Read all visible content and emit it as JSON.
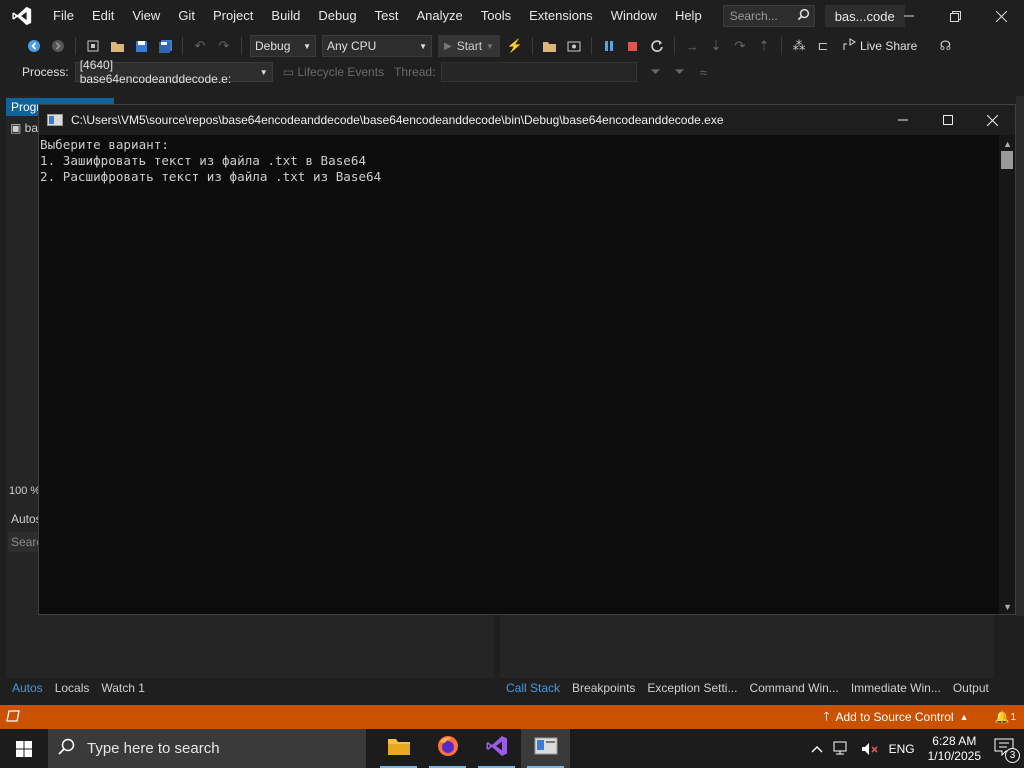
{
  "menubar": {
    "items": [
      "File",
      "Edit",
      "View",
      "Git",
      "Project",
      "Build",
      "Debug",
      "Test",
      "Analyze",
      "Tools",
      "Extensions",
      "Window",
      "Help"
    ],
    "search_placeholder": "Search...",
    "title": "bas...code"
  },
  "toolbar": {
    "config": "Debug",
    "platform": "Any CPU",
    "start_label": "Start",
    "live_share": "Live Share"
  },
  "procbar": {
    "process_label": "Process:",
    "process_value": "[4640] base64encodeanddecode.e:",
    "lifecycle_label": "Lifecycle Events",
    "thread_label": "Thread:"
  },
  "panels": {
    "left_tab": "Progr",
    "left_item": "ba",
    "zoom": "100 %",
    "autos_title": "Autos",
    "autos_search": "Searc"
  },
  "bottom_tabs_left": [
    "Autos",
    "Locals",
    "Watch 1"
  ],
  "bottom_tabs_right": [
    "Call Stack",
    "Breakpoints",
    "Exception Setti...",
    "Command Win...",
    "Immediate Win...",
    "Output"
  ],
  "statusbar": {
    "source_control": "Add to Source Control",
    "notifications": "1"
  },
  "console": {
    "title": "C:\\Users\\VM5\\source\\repos\\base64encodeanddecode\\base64encodeanddecode\\bin\\Debug\\base64encodeanddecode.exe",
    "lines": [
      "Выберите вариант:",
      "1. Зашифровать текст из файла .txt в Base64",
      "2. Расшифровать текст из файла .txt из Base64"
    ]
  },
  "taskbar": {
    "search_placeholder": "Type here to search",
    "language": "ENG",
    "time": "6:28 AM",
    "date": "1/10/2025",
    "notification_count": "3"
  },
  "colors": {
    "accent": "#0e639c",
    "statusbar": "#ca5100",
    "active_tab": "#3d9be9"
  }
}
